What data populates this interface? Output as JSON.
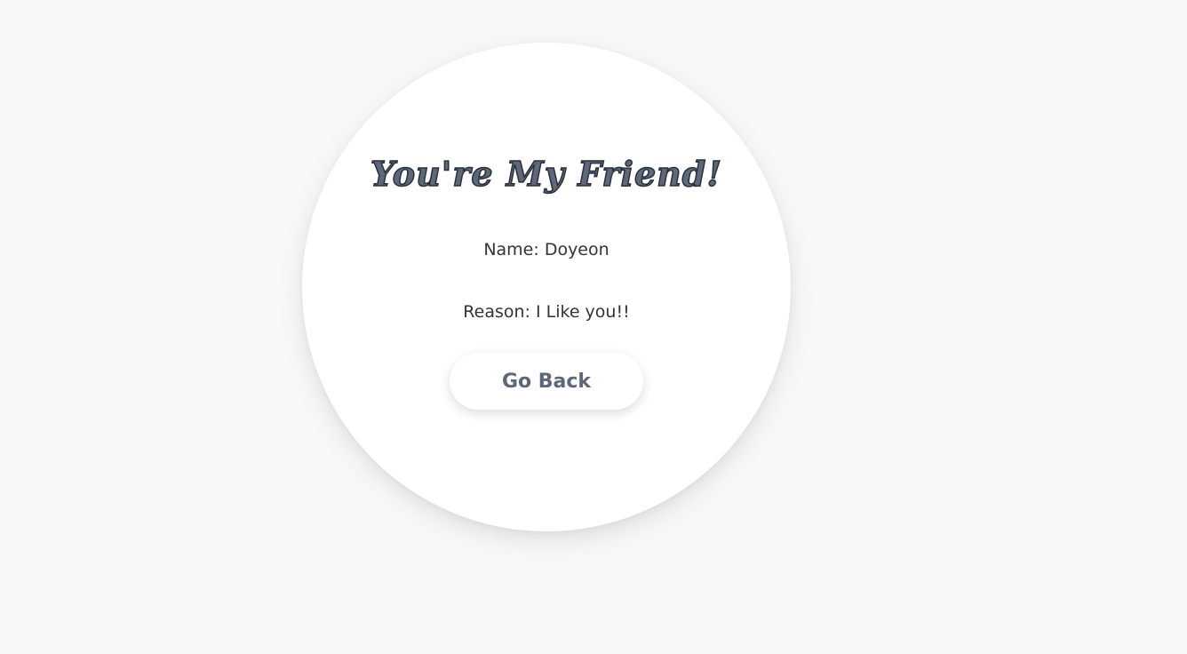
{
  "card": {
    "title": "You're My Friend!",
    "name_label": "Name: ",
    "name_value": "Doyeon",
    "reason_label": "Reason: ",
    "reason_value": "I Like you!!",
    "back_button_label": "Go Back"
  },
  "colors": {
    "background": "#f8f8f8",
    "card": "#ffffff",
    "title": "#5d687a",
    "title_outline": "#2a2f3a",
    "text": "#333333",
    "button_text": "#5d687a"
  }
}
